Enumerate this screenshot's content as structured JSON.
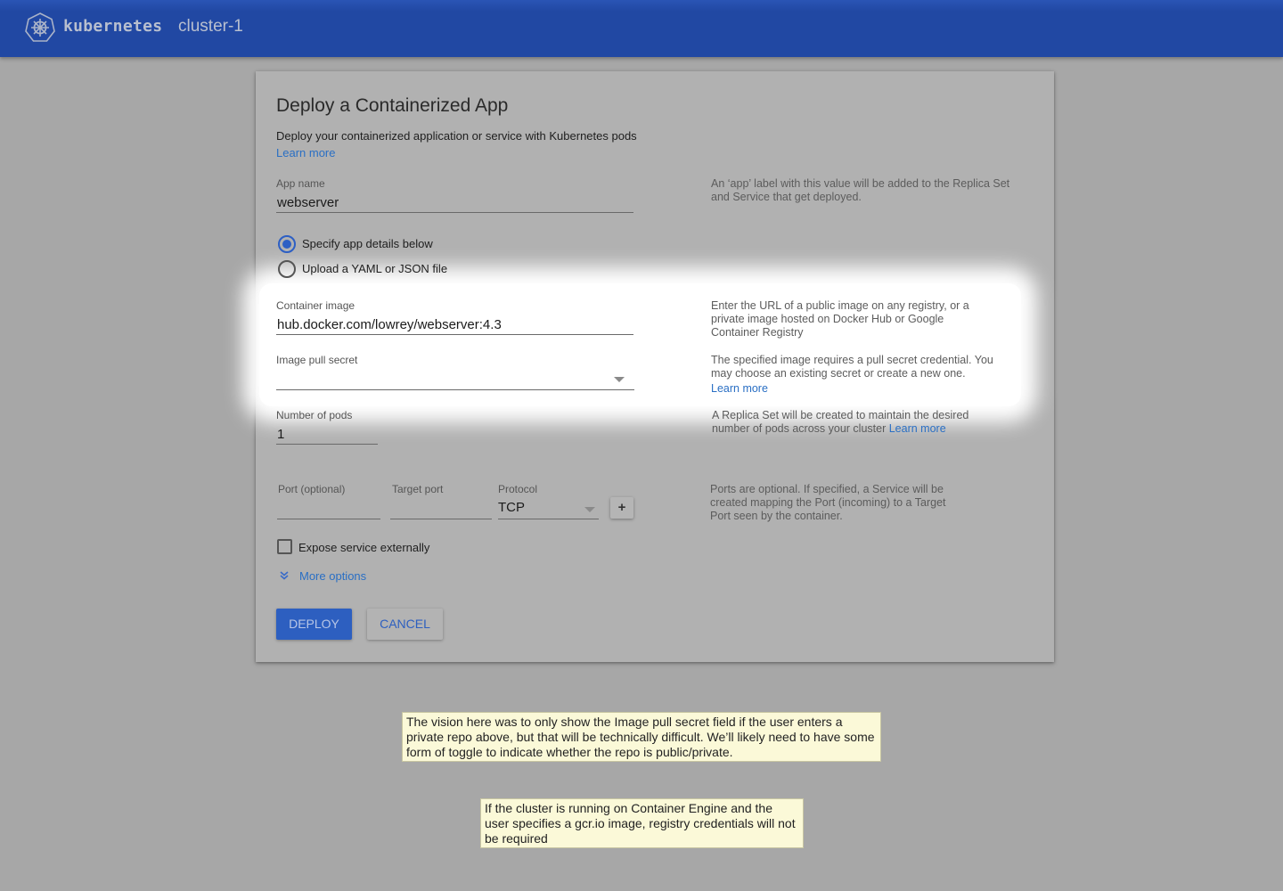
{
  "header": {
    "brand": "kubernetes",
    "cluster_name": "cluster-1",
    "logo_icon": "kubernetes-helm-wheel-icon"
  },
  "form": {
    "title": "Deploy a Containerized App",
    "subtitle": "Deploy your containerized application or service with Kubernetes pods",
    "learn_more": "Learn more",
    "app_name": {
      "label": "App name",
      "value": "webserver",
      "help": "An ‘app’ label with this value will be added to the Replica Set and Service that get deployed."
    },
    "mode_options": [
      {
        "label": "Specify app details below",
        "checked": true
      },
      {
        "label": "Upload a YAML or JSON file",
        "checked": false
      }
    ],
    "container_image": {
      "label": "Container image",
      "value": "hub.docker.com/lowrey/webserver:4.3",
      "help": "Enter the URL of a public image on any registry, or a private image hosted on Docker Hub or Google Container Registry"
    },
    "image_pull_secret": {
      "label": "Image pull secret",
      "value": "",
      "help": "The specified image requires a pull secret credential. You may choose an existing secret or create a new one.",
      "learn_more": "Learn more"
    },
    "pods": {
      "label": "Number of pods",
      "value": "1",
      "help": "A Replica Set will be created to maintain the desired number of pods across your cluster",
      "learn_more": "Learn more"
    },
    "ports": {
      "port_label": "Port (optional)",
      "port_value": "",
      "target_label": "Target port",
      "target_value": "",
      "protocol_label": "Protocol",
      "protocol_value": "TCP",
      "add_label": "+",
      "help": "Ports are optional.  If specified, a Service will be created mapping the Port (incoming) to a Target Port seen by the container."
    },
    "expose": {
      "label": "Expose service externally",
      "checked": false
    },
    "more_options": "More options",
    "deploy_label": "DEPLOY",
    "cancel_label": "CANCEL"
  },
  "annotations": [
    {
      "text": "The vision here was to only show the Image pull secret field if the user enters a private repo above, but that will be technically difficult.  We’ll likely need to have some form of toggle to indicate whether the repo is public/private."
    },
    {
      "text": "If the cluster is running on Container Engine and the user specifies a gcr.io image, registry credentials will not be required"
    }
  ]
}
